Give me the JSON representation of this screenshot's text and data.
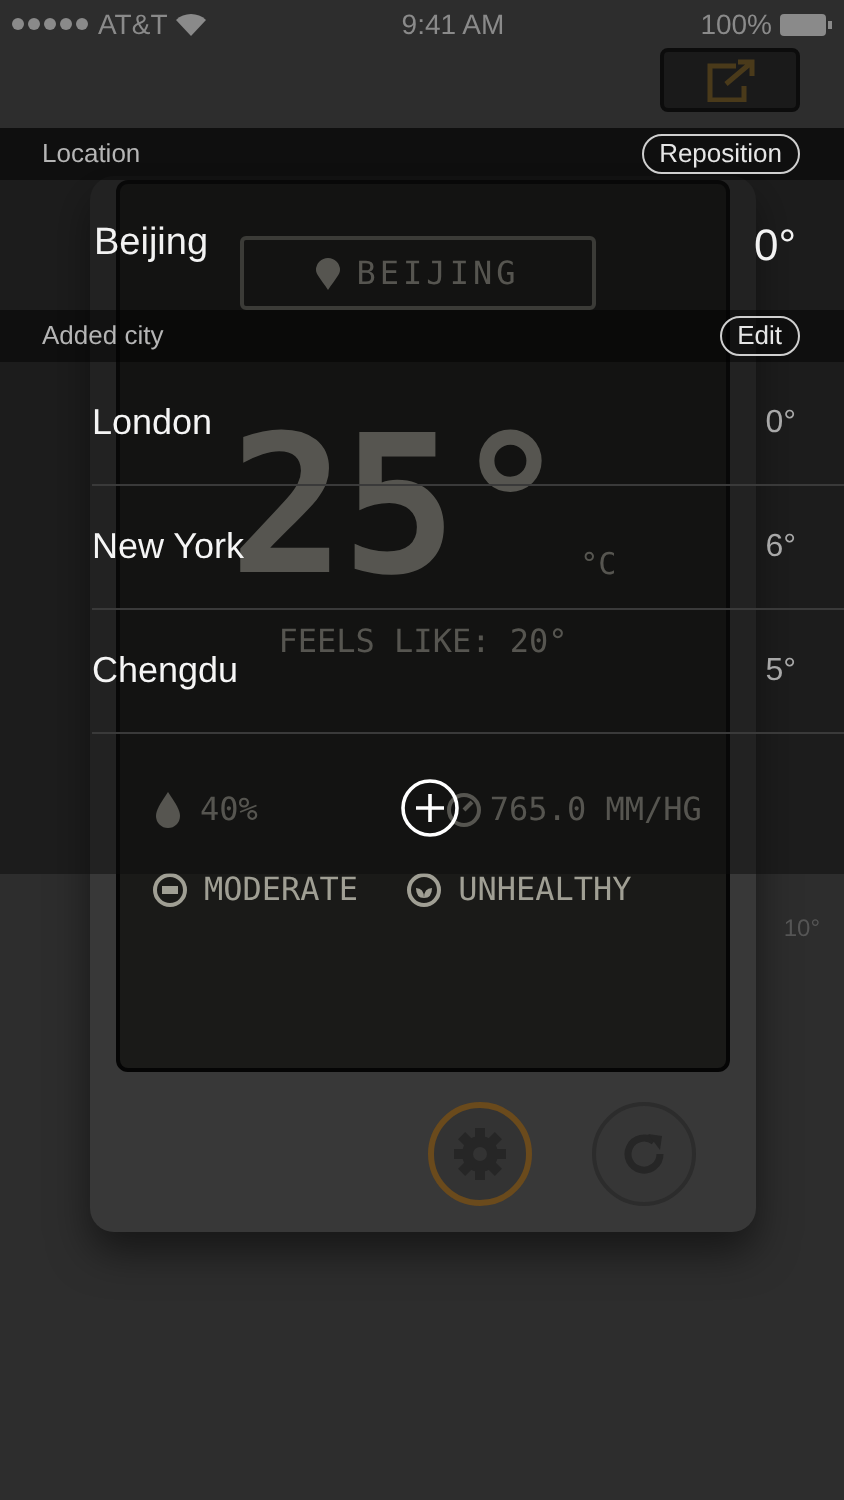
{
  "status_bar": {
    "carrier": "AT&T",
    "time": "9:41 AM",
    "battery": "100%"
  },
  "device": {
    "location": "BEIJING",
    "temperature": "25°",
    "unit": "°C",
    "feels_like": "FEELS LIKE: 20°",
    "humidity": "40%",
    "pressure": "765.0 MM/HG",
    "uv": "MODERATE",
    "air_quality": "UNHEALTHY",
    "side_reading": "10°"
  },
  "city_list": {
    "location_header": "Location",
    "reposition_button": "Reposition",
    "current": {
      "name": "Beijing",
      "temp": "0°"
    },
    "added_header": "Added city",
    "edit_button": "Edit",
    "cities": [
      {
        "name": "London",
        "temp": "0°"
      },
      {
        "name": "New York",
        "temp": "6°"
      },
      {
        "name": "Chengdu",
        "temp": "5°"
      }
    ]
  }
}
